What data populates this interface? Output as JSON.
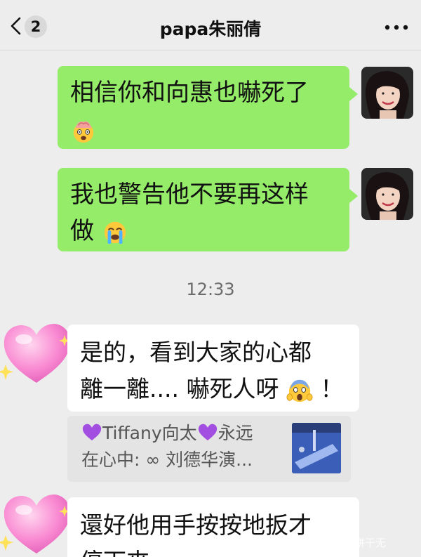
{
  "header": {
    "unread_count": "2",
    "title": "papa朱丽倩"
  },
  "messages": {
    "out_1": "相信你和向惠也嚇死了",
    "out_2_line1": "我也警告他不要再这样",
    "out_2_line2": "做",
    "timestamp": "12:33",
    "in_1_line1": "是的，看到大家的心都",
    "in_1_line2": "離一離.... 嚇死人呀",
    "in_1_tail": "！",
    "in_2_line1": "還好他用手按按地扳才",
    "in_2_line2": "停下來"
  },
  "quote": {
    "line1_part1": "Tiffany向太",
    "line1_part2": "永远",
    "line2": "在心中: ∞ 刘德华演..."
  },
  "watermark": "娱乐小饼干无",
  "colors": {
    "bubble_out": "#95ec69",
    "bubble_in": "#ffffff",
    "background": "#ededed"
  },
  "icons": {
    "back": "chevron-left-icon",
    "more": "more-dots-icon",
    "emoji_1": "exploding-head-emoji",
    "emoji_2": "crying-face-emoji",
    "emoji_3": "screaming-face-emoji"
  }
}
